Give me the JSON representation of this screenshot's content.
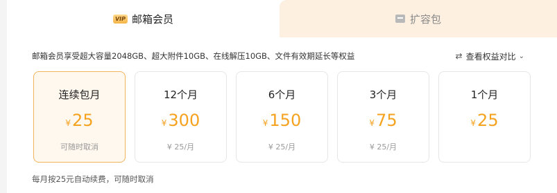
{
  "tabs": [
    {
      "label": "邮箱会员",
      "icon": "vip-badge-icon",
      "active": true,
      "badge_text": "VIP"
    },
    {
      "label": "扩容包",
      "icon": "package-icon",
      "active": false
    }
  ],
  "description": "邮箱会员享受超大容量2048GB、超大附件10GB、在线解压10GB、文件有效期延长等权益",
  "compare_link": "查看权益对比",
  "plans": [
    {
      "title": "连续包月",
      "currency": "¥",
      "price": "25",
      "sub": "可随时取消",
      "selected": true
    },
    {
      "title": "12个月",
      "currency": "¥",
      "price": "300",
      "sub": "¥ 25/月",
      "selected": false
    },
    {
      "title": "6个月",
      "currency": "¥",
      "price": "150",
      "sub": "¥ 25/月",
      "selected": false
    },
    {
      "title": "3个月",
      "currency": "¥",
      "price": "75",
      "sub": "¥ 25/月",
      "selected": false
    },
    {
      "title": "1个月",
      "currency": "¥",
      "price": "25",
      "sub": "",
      "selected": false
    }
  ],
  "footer_note": "每月按25元自动续费，可随时取消",
  "colors": {
    "accent": "#f5a21f",
    "selected_bg": "#fff8ef",
    "selected_border": "#f2b35d",
    "inactive_tab_bg": "#fdf0e1"
  }
}
